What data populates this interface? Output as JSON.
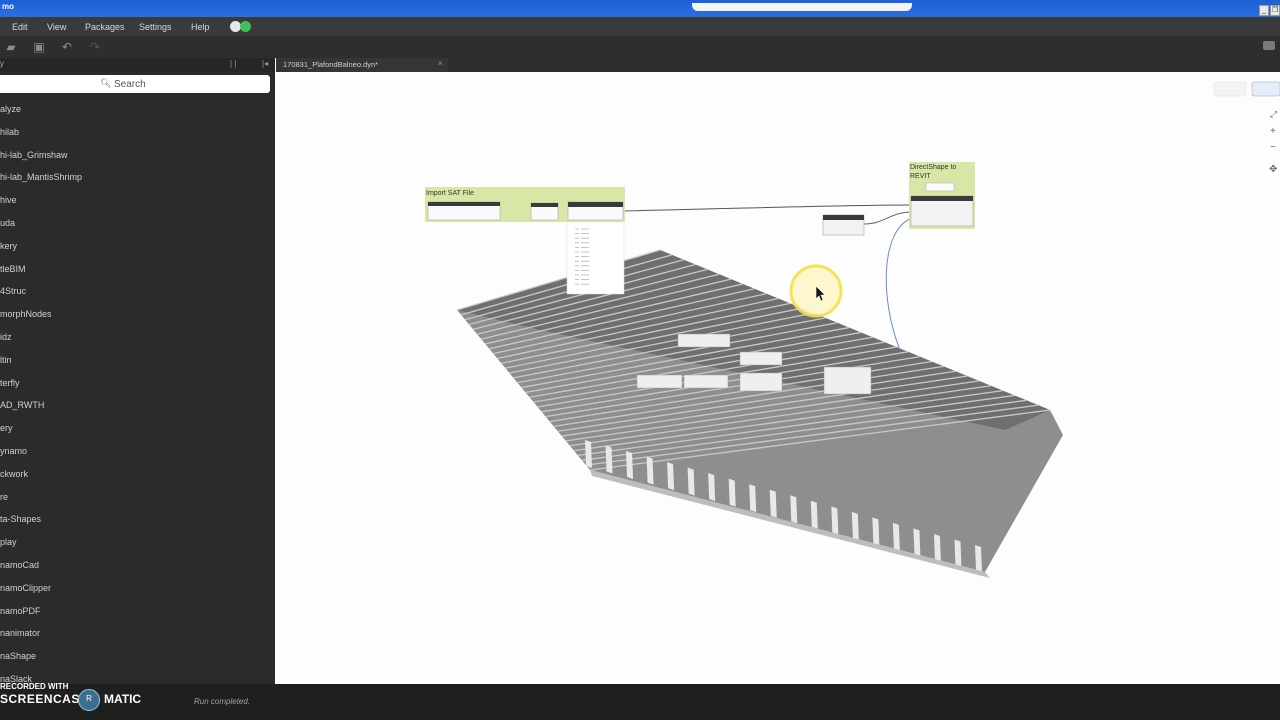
{
  "app": {
    "title": "mo"
  },
  "menu": [
    "Edit",
    "View",
    "Packages",
    "Settings",
    "Help"
  ],
  "library": {
    "header": "y",
    "search_placeholder": "Search",
    "items": [
      "alyze",
      "hilab",
      "hi-lab_Grimshaw",
      "hi-lab_MantisShrimp",
      "hive",
      "uda",
      "kery",
      "tleBIM",
      "4Struc",
      "morphNodes",
      "idz",
      "ltin",
      "terfly",
      "AD_RWTH",
      "ery",
      "ynamo",
      "ckwork",
      "re",
      "ta-Shapes",
      "play",
      "namoCad",
      "namoClipper",
      "namoPDF",
      "nanimator",
      "naShape",
      "naSlack"
    ]
  },
  "tab": {
    "label": "170831_PlafondBalneo.dyn*",
    "close": "×"
  },
  "nodes": {
    "import_sat": "Import SAT File",
    "directshape": "DirectShape to REVIT"
  },
  "status": {
    "text": "Run completed."
  },
  "watermark": {
    "line1": "RECORDED WITH",
    "brand_a": "SCREENCAST",
    "brand_b": "MATIC",
    "logo": "R"
  },
  "colors": {
    "node_header": "#d9e7a6",
    "menubar": "#3a3a3a",
    "titlebar": "#1c5fd6",
    "toggle_a": "#e6e6e6",
    "toggle_b": "#3fbf5b",
    "cursor_highlight": "#f4e24b"
  }
}
